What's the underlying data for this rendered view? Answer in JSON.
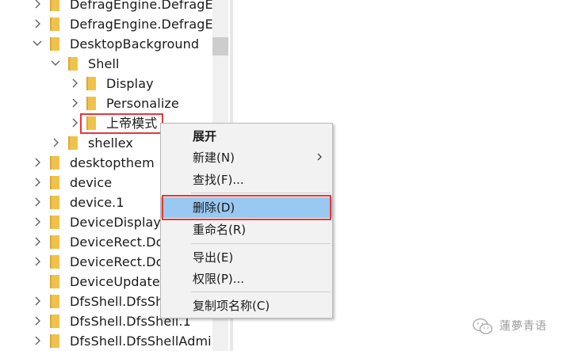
{
  "tree": {
    "items": [
      {
        "label": "DefragEngine.DefragE"
      },
      {
        "label": "DefragEngine.DefragE"
      },
      {
        "label": "DesktopBackground"
      },
      {
        "label": "Shell"
      },
      {
        "label": "Display"
      },
      {
        "label": "Personalize"
      },
      {
        "label": "上帝模式"
      },
      {
        "label": "shellex"
      },
      {
        "label": "desktopthem"
      },
      {
        "label": "device"
      },
      {
        "label": "device.1"
      },
      {
        "label": "DeviceDisplay"
      },
      {
        "label": "DeviceRect.Dc"
      },
      {
        "label": "DeviceRect.Dc"
      },
      {
        "label": "DeviceUpdate"
      },
      {
        "label": "DfsShell.DfsSh"
      },
      {
        "label": "DfsShell.DfsShell.1"
      },
      {
        "label": "DfsShell.DfsShellAdmi"
      }
    ]
  },
  "context_menu": {
    "expand": "展开",
    "new": "新建(N)",
    "find": "查找(F)...",
    "delete": "删除(D)",
    "rename": "重命名(R)",
    "export": "导出(E)",
    "permissions": "权限(P)...",
    "copy_key_name": "复制项名称(C)"
  },
  "watermark": {
    "text": "蓮夢青语"
  },
  "colors": {
    "folder": "#f0c24b",
    "highlight_border": "#e3383b",
    "menu_selected": "#99c8f0",
    "menu_background": "#f2f2f2"
  }
}
